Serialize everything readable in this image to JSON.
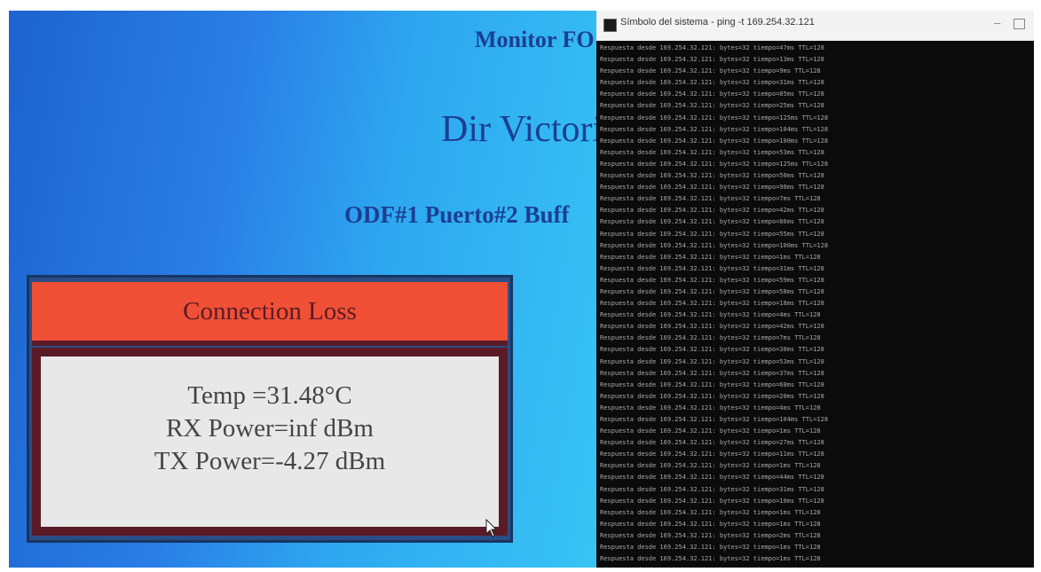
{
  "monitor": {
    "title": "Monitor FO",
    "location": "Dir Victori",
    "port": "ODF#1 Puerto#2 Buff",
    "status": "Connection Loss",
    "readings": [
      "Temp =31.48°C",
      "RX Power=inf dBm",
      "TX Power=-4.27 dBm"
    ]
  },
  "console": {
    "title": "Símbolo del sistema - ping -t 169.254.32.121",
    "lines": [
      "Respuesta desde 169.254.32.121: bytes=32 tiempo=47ms TTL=128",
      "Respuesta desde 169.254.32.121: bytes=32 tiempo=13ms TTL=128",
      "Respuesta desde 169.254.32.121: bytes=32 tiempo=9ms TTL=128",
      "Respuesta desde 169.254.32.121: bytes=32 tiempo=31ms TTL=128",
      "Respuesta desde 169.254.32.121: bytes=32 tiempo=85ms TTL=128",
      "Respuesta desde 169.254.32.121: bytes=32 tiempo=25ms TTL=128",
      "Respuesta desde 169.254.32.121: bytes=32 tiempo=125ms TTL=128",
      "Respuesta desde 169.254.32.121: bytes=32 tiempo=104ms TTL=128",
      "Respuesta desde 169.254.32.121: bytes=32 tiempo=100ms TTL=128",
      "Respuesta desde 169.254.32.121: bytes=32 tiempo=53ms TTL=128",
      "Respuesta desde 169.254.32.121: bytes=32 tiempo=125ms TTL=128",
      "Respuesta desde 169.254.32.121: bytes=32 tiempo=50ms TTL=128",
      "Respuesta desde 169.254.32.121: bytes=32 tiempo=98ms TTL=128",
      "Respuesta desde 169.254.32.121: bytes=32 tiempo=7ms TTL=128",
      "Respuesta desde 169.254.32.121: bytes=32 tiempo=42ms TTL=128",
      "Respuesta desde 169.254.32.121: bytes=32 tiempo=86ms TTL=128",
      "Respuesta desde 169.254.32.121: bytes=32 tiempo=55ms TTL=128",
      "Respuesta desde 169.254.32.121: bytes=32 tiempo=100ms TTL=128",
      "Respuesta desde 169.254.32.121: bytes=32 tiempo=1ms TTL=128",
      "Respuesta desde 169.254.32.121: bytes=32 tiempo=31ms TTL=128",
      "Respuesta desde 169.254.32.121: bytes=32 tiempo=59ms TTL=128",
      "Respuesta desde 169.254.32.121: bytes=32 tiempo=58ms TTL=128",
      "Respuesta desde 169.254.32.121: bytes=32 tiempo=18ms TTL=128",
      "Respuesta desde 169.254.32.121: bytes=32 tiempo=4ms TTL=128",
      "Respuesta desde 169.254.32.121: bytes=32 tiempo=42ms TTL=128",
      "Respuesta desde 169.254.32.121: bytes=32 tiempo=7ms TTL=128",
      "Respuesta desde 169.254.32.121: bytes=32 tiempo=30ms TTL=128",
      "Respuesta desde 169.254.32.121: bytes=32 tiempo=53ms TTL=128",
      "Respuesta desde 169.254.32.121: bytes=32 tiempo=37ms TTL=128",
      "Respuesta desde 169.254.32.121: bytes=32 tiempo=68ms TTL=128",
      "Respuesta desde 169.254.32.121: bytes=32 tiempo=20ms TTL=128",
      "Respuesta desde 169.254.32.121: bytes=32 tiempo=4ms TTL=128",
      "Respuesta desde 169.254.32.121: bytes=32 tiempo=104ms TTL=128",
      "Respuesta desde 169.254.32.121: bytes=32 tiempo=1ms TTL=128",
      "Respuesta desde 169.254.32.121: bytes=32 tiempo=27ms TTL=128",
      "Respuesta desde 169.254.32.121: bytes=32 tiempo=11ms TTL=128",
      "Respuesta desde 169.254.32.121: bytes=32 tiempo=1ms TTL=128",
      "Respuesta desde 169.254.32.121: bytes=32 tiempo=44ms TTL=128",
      "Respuesta desde 169.254.32.121: bytes=32 tiempo=31ms TTL=128",
      "Respuesta desde 169.254.32.121: bytes=32 tiempo=10ms TTL=128",
      "Respuesta desde 169.254.32.121: bytes=32 tiempo=1ms TTL=128",
      "Respuesta desde 169.254.32.121: bytes=32 tiempo=1ms TTL=128",
      "Respuesta desde 169.254.32.121: bytes=32 tiempo=2ms TTL=128",
      "Respuesta desde 169.254.32.121: bytes=32 tiempo=1ms TTL=128",
      "Respuesta desde 169.254.32.121: bytes=32 tiempo=1ms TTL=128",
      "Respuesta desde 169.254.32.121: bytes=32 tiempo=1ms TTL=128"
    ]
  }
}
